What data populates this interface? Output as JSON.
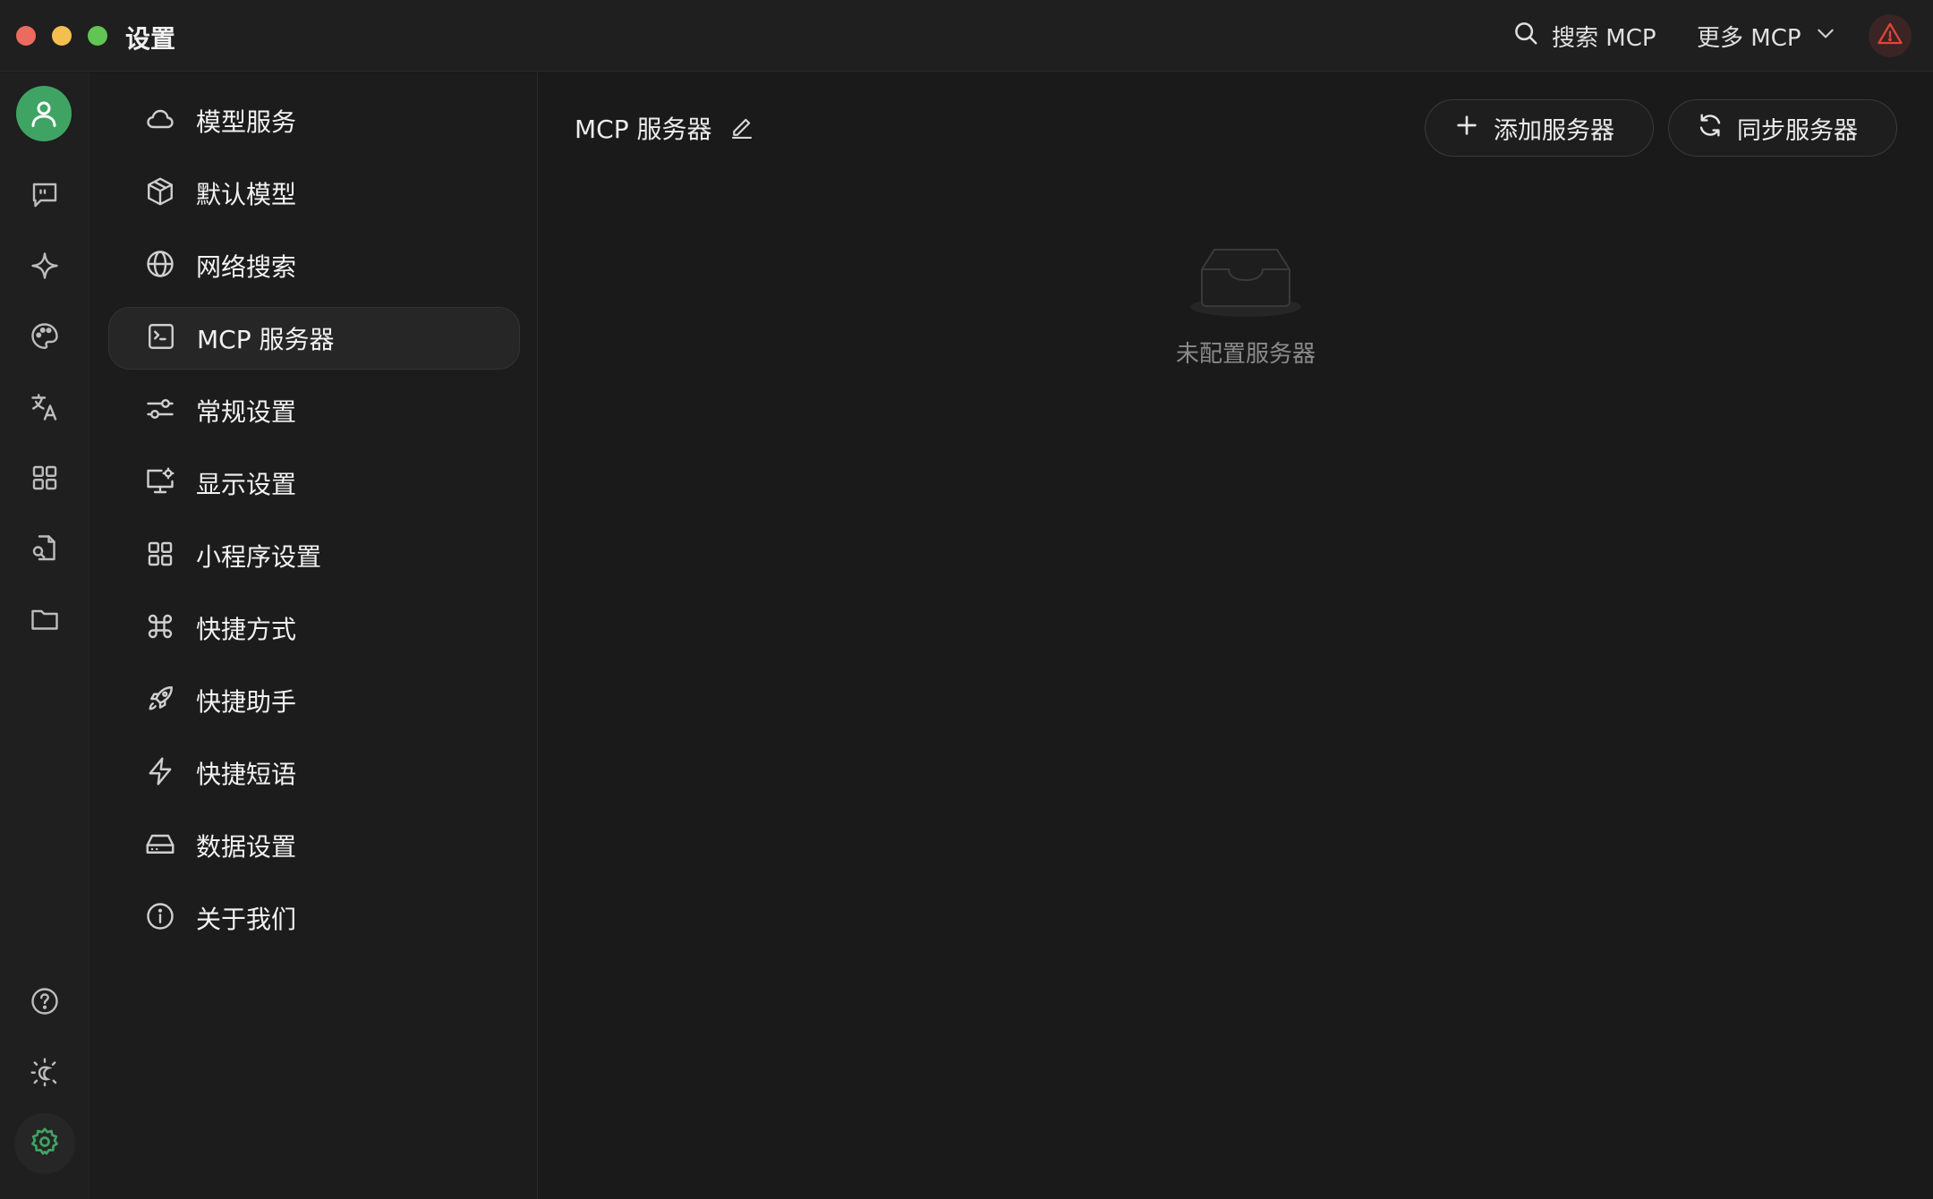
{
  "window": {
    "title": "设置"
  },
  "titlebar": {
    "search_label": "搜索 MCP",
    "more_label": "更多 MCP"
  },
  "rail": {
    "icons": [
      "avatar-icon",
      "chat-icon",
      "sparkle-icon",
      "palette-icon",
      "translate-icon",
      "apps-grid-icon",
      "file-search-icon",
      "folder-icon",
      "help-icon",
      "theme-toggle-icon",
      "settings-icon"
    ],
    "accent_color": "#3fa463"
  },
  "sidebar": {
    "items": [
      {
        "label": "模型服务",
        "icon": "cloud-icon"
      },
      {
        "label": "默认模型",
        "icon": "cube-icon"
      },
      {
        "label": "网络搜索",
        "icon": "globe-icon"
      },
      {
        "label": "MCP 服务器",
        "icon": "terminal-icon",
        "active": true
      },
      {
        "label": "常规设置",
        "icon": "sliders-icon"
      },
      {
        "label": "显示设置",
        "icon": "monitor-settings-icon"
      },
      {
        "label": "小程序设置",
        "icon": "grid-icon"
      },
      {
        "label": "快捷方式",
        "icon": "command-icon"
      },
      {
        "label": "快捷助手",
        "icon": "rocket-icon"
      },
      {
        "label": "快捷短语",
        "icon": "lightning-icon"
      },
      {
        "label": "数据设置",
        "icon": "drive-icon"
      },
      {
        "label": "关于我们",
        "icon": "info-icon"
      }
    ]
  },
  "main": {
    "title": "MCP 服务器",
    "add_button": "添加服务器",
    "sync_button": "同步服务器",
    "empty_text": "未配置服务器"
  },
  "colors": {
    "warning": "#e0453a",
    "annotation_arrow": "#e8261c"
  }
}
